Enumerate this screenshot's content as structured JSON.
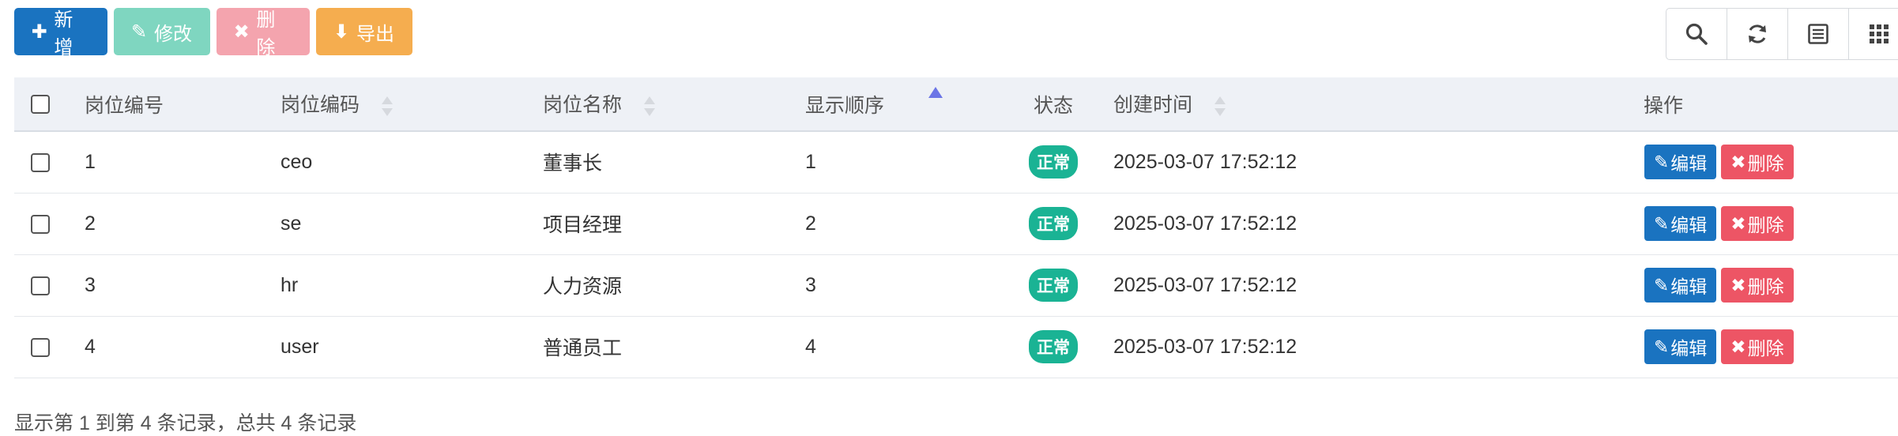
{
  "toolbar": {
    "add_label": "新增",
    "edit_label": "修改",
    "delete_label": "删除",
    "export_label": "导出"
  },
  "table": {
    "headers": {
      "post_id": "岗位编号",
      "post_code": "岗位编码",
      "post_name": "岗位名称",
      "sort": "显示顺序",
      "status": "状态",
      "create_time": "创建时间",
      "actions": "操作"
    },
    "rows": [
      {
        "id": "1",
        "code": "ceo",
        "name": "董事长",
        "sort": "1",
        "status": "正常",
        "create_time": "2025-03-07 17:52:12"
      },
      {
        "id": "2",
        "code": "se",
        "name": "项目经理",
        "sort": "2",
        "status": "正常",
        "create_time": "2025-03-07 17:52:12"
      },
      {
        "id": "3",
        "code": "hr",
        "name": "人力资源",
        "sort": "3",
        "status": "正常",
        "create_time": "2025-03-07 17:52:12"
      },
      {
        "id": "4",
        "code": "user",
        "name": "普通员工",
        "sort": "4",
        "status": "正常",
        "create_time": "2025-03-07 17:52:12"
      }
    ],
    "row_edit_label": "编辑",
    "row_delete_label": "删除"
  },
  "footer": {
    "summary": "显示第 1 到第 4 条记录，总共 4 条记录"
  },
  "colors": {
    "primary": "#1a73c0",
    "success": "#1ab394",
    "danger": "#ed5565",
    "warning": "#f5ad4f"
  },
  "icons": [
    "plus-icon",
    "edit-icon",
    "close-icon",
    "download-icon",
    "search-icon",
    "refresh-icon",
    "list-icon",
    "grid-icon"
  ]
}
